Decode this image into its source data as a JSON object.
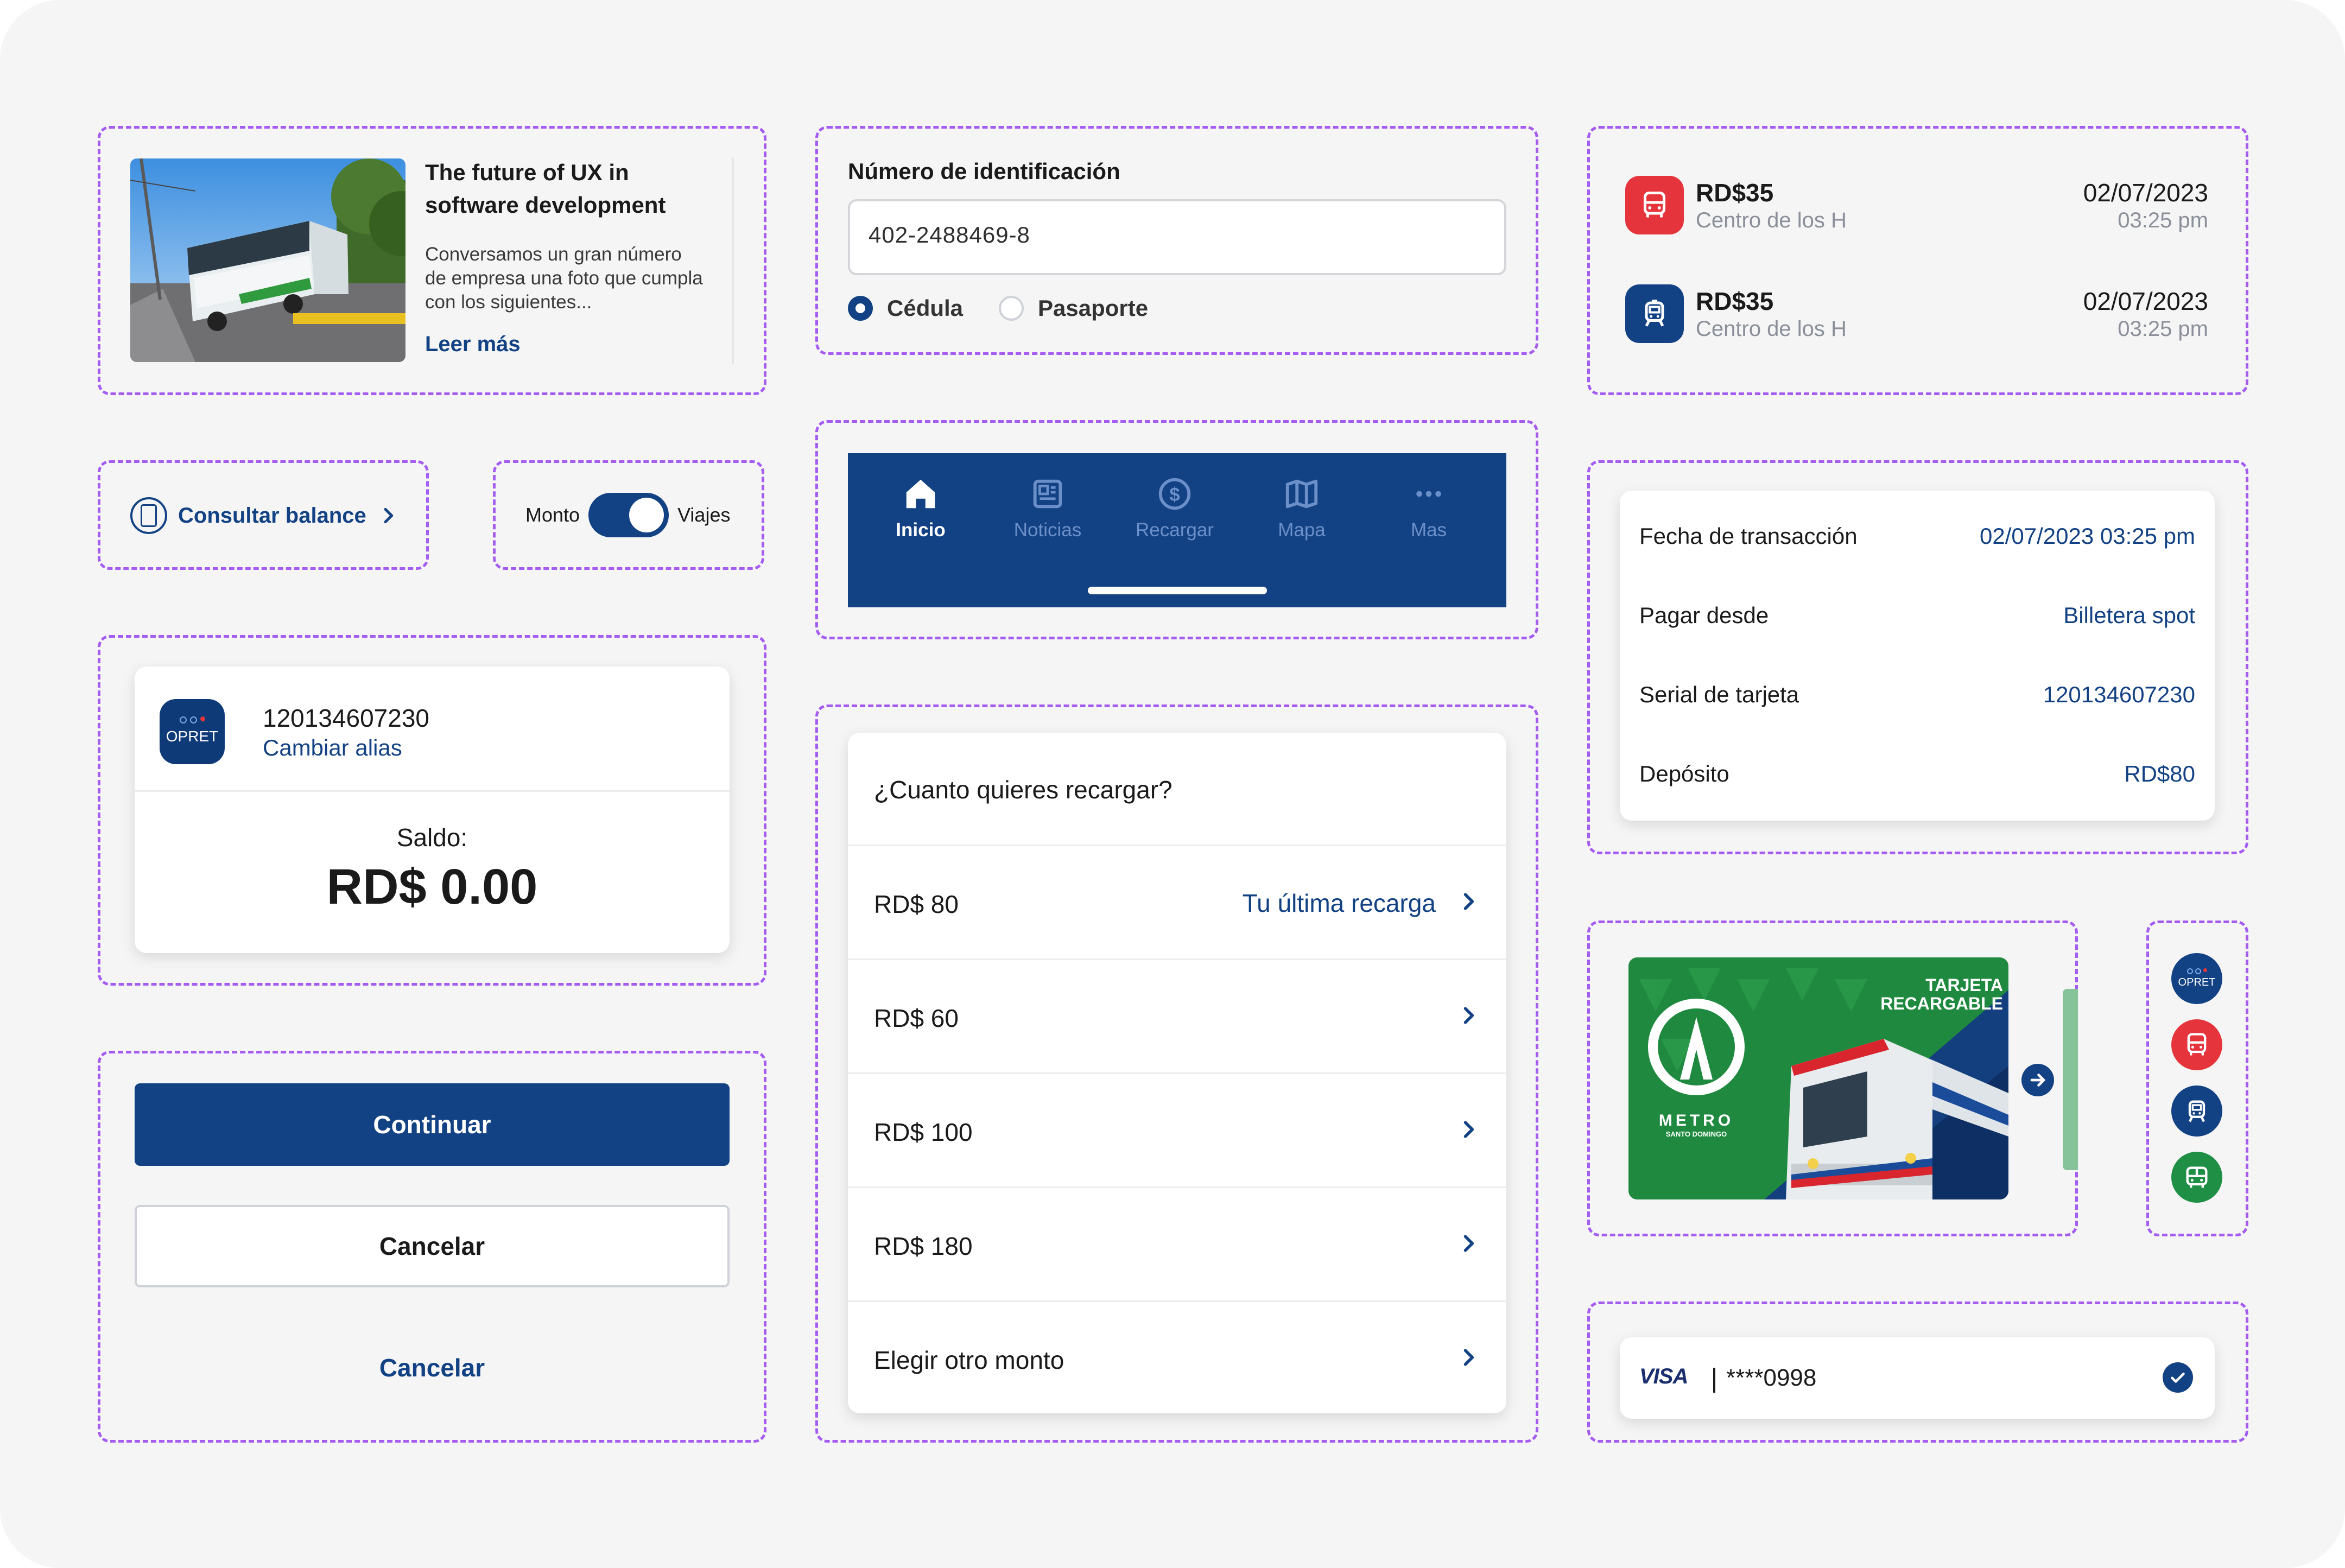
{
  "colors": {
    "navy": "#134284",
    "red": "#e5343c",
    "green": "#1f8f45",
    "frame": "#a55cf0"
  },
  "news": {
    "title": "The future of UX in software development",
    "description": "Conversamos un gran número de empresa una foto que cumpla con  los siguientes...",
    "link": "Leer más"
  },
  "id_form": {
    "label": "Número de identificación",
    "value": "402-2488469-8",
    "options": [
      "Cédula",
      "Pasaporte"
    ],
    "selected": "Cédula"
  },
  "transactions": [
    {
      "icon": "bus-icon",
      "amount": "RD$35",
      "place": "Centro de los H",
      "date": "02/07/2023",
      "time": "03:25 pm"
    },
    {
      "icon": "metro-train-icon",
      "amount": "RD$35",
      "place": "Centro de los H",
      "date": "02/07/2023",
      "time": "03:25 pm"
    }
  ],
  "balance_button": {
    "label": "Consultar balance",
    "icon": "card-icon"
  },
  "toggle": {
    "left": "Monto",
    "right": "Viajes",
    "on": true
  },
  "navbar": {
    "items": [
      {
        "label": "Inicio",
        "icon": "home-icon",
        "active": true
      },
      {
        "label": "Noticias",
        "icon": "news-icon",
        "active": false
      },
      {
        "label": "Recargar",
        "icon": "dollar-icon",
        "active": false
      },
      {
        "label": "Mapa",
        "icon": "map-icon",
        "active": false
      },
      {
        "label": "Mas",
        "icon": "more-icon",
        "active": false
      }
    ]
  },
  "details": {
    "rows": [
      {
        "label": "Fecha de transacción",
        "value": "02/07/2023 03:25 pm"
      },
      {
        "label": "Pagar desde",
        "value": "Billetera spot"
      },
      {
        "label": "Serial de tarjeta",
        "value": "120134607230"
      },
      {
        "label": "Depósito",
        "value": "RD$80"
      }
    ]
  },
  "card_alias": {
    "logo": "OPRET",
    "number": "120134607230",
    "link": "Cambiar alias",
    "saldo_label": "Saldo:",
    "saldo_value": "RD$ 0.00"
  },
  "recharge": {
    "question": "¿Cuanto quieres recargar?",
    "options": [
      {
        "label": "RD$ 80",
        "hint": "Tu última recarga"
      },
      {
        "label": "RD$ 60",
        "hint": ""
      },
      {
        "label": "RD$ 100",
        "hint": ""
      },
      {
        "label": "RD$ 180",
        "hint": ""
      },
      {
        "label": "Elegir otro monto",
        "hint": ""
      }
    ]
  },
  "buttons": {
    "primary": "Continuar",
    "outline": "Cancelar",
    "text": "Cancelar"
  },
  "metro_card": {
    "title_line1": "TARJETA",
    "title_line2": "RECARGABLE",
    "brand": "METRO",
    "brand_sub": "SANTO DOMINGO"
  },
  "icon_column": {
    "items": [
      "opret-icon",
      "bus-icon",
      "metro-train-icon",
      "bus-front-icon"
    ],
    "logo": "OPRET"
  },
  "payment": {
    "brand": "VISA",
    "masked": "****0998"
  }
}
